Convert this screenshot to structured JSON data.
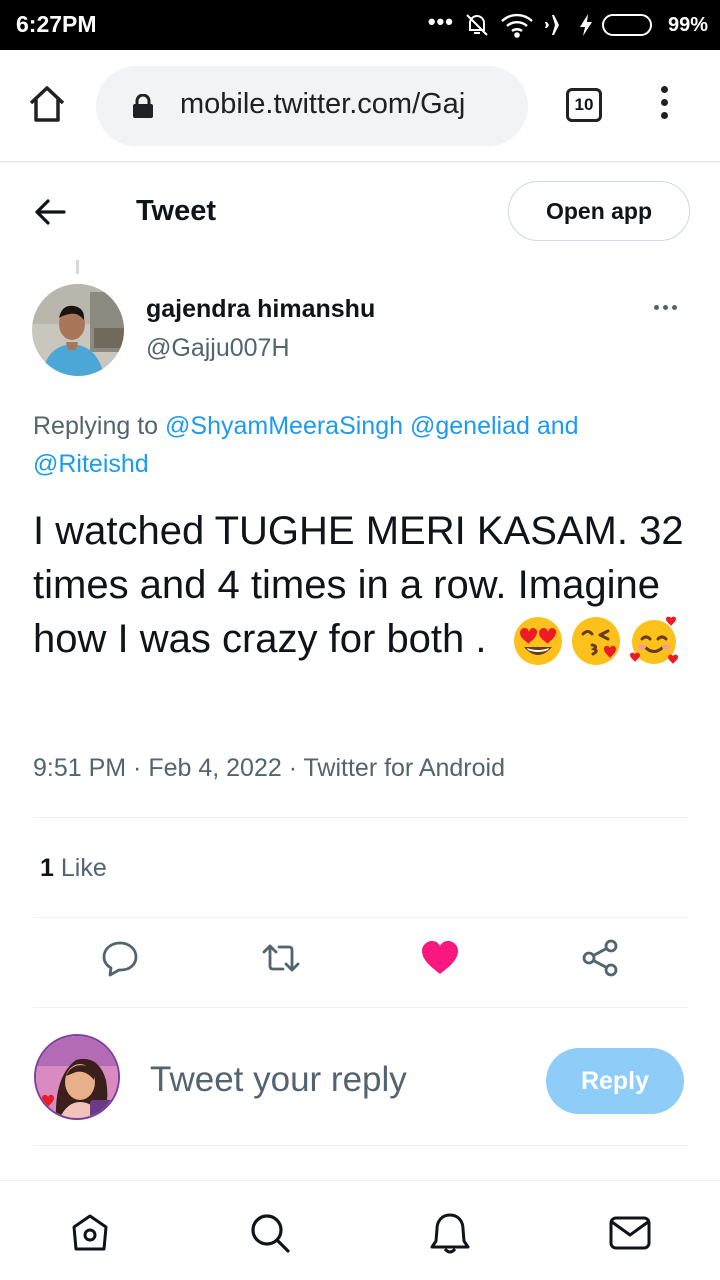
{
  "status_bar": {
    "time": "6:27PM",
    "battery_percent": "99%",
    "battery_level": 0.99,
    "icons": [
      "more-dots-icon",
      "mute-icon",
      "wifi-icon",
      "airplane-icon",
      "charging-icon",
      "battery-icon"
    ]
  },
  "browser": {
    "url": "mobile.twitter.com/Gaj",
    "tab_count": "10",
    "icons": [
      "home-icon",
      "lock-icon",
      "tabs-icon",
      "menu-icon"
    ]
  },
  "header": {
    "title": "Tweet",
    "open_app_label": "Open app"
  },
  "tweet": {
    "author_name": "gajendra himanshu",
    "author_handle": "@Gajju007H",
    "replying_prefix": "Replying to",
    "mention_1": "@ShyamMeeraSingh",
    "mention_2": "@geneliad",
    "and_word": "and",
    "mention_3": "@Riteishd",
    "text": "I watched TUGHE MERI KASAM. 32 times and 4 times in a row. Imagine how I was crazy for both .",
    "emojis": [
      "heart-eyes-emoji",
      "kissing-heart-emoji",
      "smiling-hearts-emoji"
    ],
    "meta": "9:51 PM · Feb 4, 2022 · Twitter for Android",
    "like_count": "1",
    "like_label": "Like"
  },
  "actions": [
    "reply-icon",
    "retweet-icon",
    "like-icon",
    "share-icon"
  ],
  "reply_composer": {
    "placeholder": "Tweet your reply",
    "button_label": "Reply"
  },
  "bottom_nav": [
    "home-icon",
    "search-icon",
    "notifications-icon",
    "messages-icon"
  ],
  "colors": {
    "accent": "#1d9bf0",
    "like": "#f91880",
    "reply_button": "#8ecdf8",
    "secondary_text": "#536471"
  }
}
